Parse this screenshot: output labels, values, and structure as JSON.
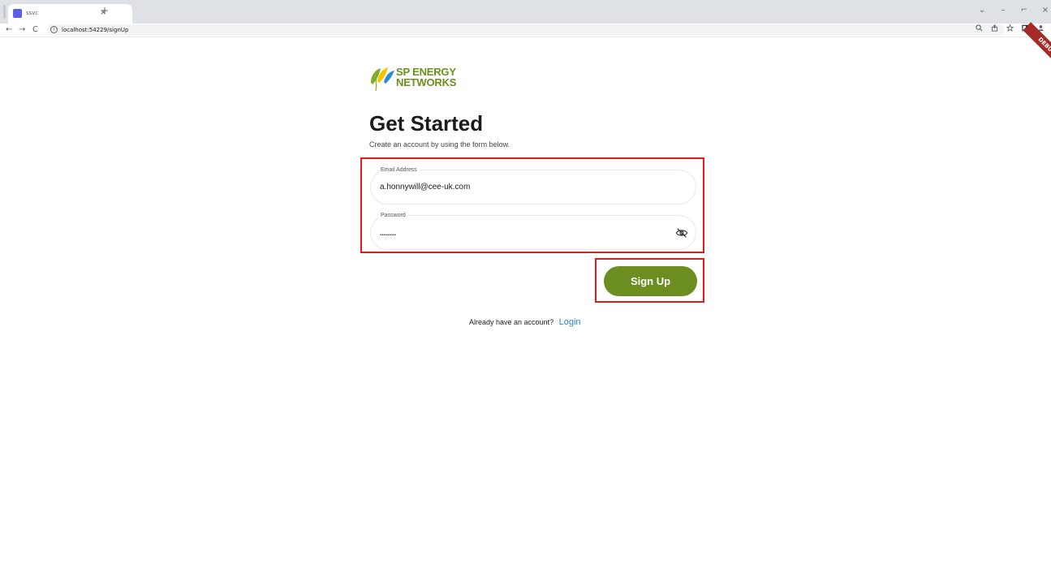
{
  "browser": {
    "tab_title": "ssvc",
    "tab_close": "×",
    "new_tab": "+",
    "url": "localhost:54229/signUp",
    "nav_back": "←",
    "nav_forward": "→",
    "nav_reload": "C",
    "window_controls": [
      "⌄",
      "–",
      "⌐",
      "×"
    ],
    "toolbar_icons": [
      "zoom-icon",
      "share-icon",
      "star-icon",
      "sidepanel-icon",
      "profile-icon"
    ]
  },
  "debug_banner": "DEBUG",
  "logo": {
    "line1": "SP ENERGY",
    "line2": "NETWORKS",
    "colors": {
      "text": "#6a8f1d",
      "leaf_green": "#7fae2c",
      "leaf_yellow": "#f2c500",
      "leaf_blue": "#2a8ed6"
    }
  },
  "page": {
    "title": "Get Started",
    "subtitle": "Create an account by using the form below."
  },
  "form": {
    "email": {
      "label": "Email Address",
      "value": "a.honnywill@cee-uk.com"
    },
    "password": {
      "label": "Password",
      "value": "........"
    },
    "signup_label": "Sign Up"
  },
  "footer": {
    "prompt": "Already have an account?",
    "login_label": "Login"
  },
  "colors": {
    "accent": "#6c8e21",
    "link": "#2a86d6",
    "highlight": "#e31b1b"
  }
}
